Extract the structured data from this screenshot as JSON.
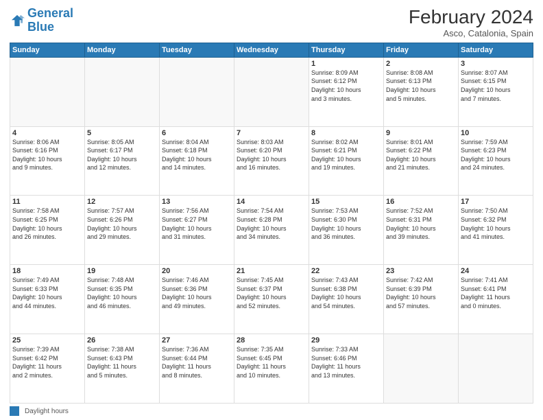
{
  "header": {
    "logo_line1": "General",
    "logo_line2": "Blue",
    "month_year": "February 2024",
    "location": "Asco, Catalonia, Spain"
  },
  "days_of_week": [
    "Sunday",
    "Monday",
    "Tuesday",
    "Wednesday",
    "Thursday",
    "Friday",
    "Saturday"
  ],
  "footer": {
    "legend_label": "Daylight hours"
  },
  "weeks": [
    [
      {
        "day": "",
        "info": ""
      },
      {
        "day": "",
        "info": ""
      },
      {
        "day": "",
        "info": ""
      },
      {
        "day": "",
        "info": ""
      },
      {
        "day": "1",
        "info": "Sunrise: 8:09 AM\nSunset: 6:12 PM\nDaylight: 10 hours\nand 3 minutes."
      },
      {
        "day": "2",
        "info": "Sunrise: 8:08 AM\nSunset: 6:13 PM\nDaylight: 10 hours\nand 5 minutes."
      },
      {
        "day": "3",
        "info": "Sunrise: 8:07 AM\nSunset: 6:15 PM\nDaylight: 10 hours\nand 7 minutes."
      }
    ],
    [
      {
        "day": "4",
        "info": "Sunrise: 8:06 AM\nSunset: 6:16 PM\nDaylight: 10 hours\nand 9 minutes."
      },
      {
        "day": "5",
        "info": "Sunrise: 8:05 AM\nSunset: 6:17 PM\nDaylight: 10 hours\nand 12 minutes."
      },
      {
        "day": "6",
        "info": "Sunrise: 8:04 AM\nSunset: 6:18 PM\nDaylight: 10 hours\nand 14 minutes."
      },
      {
        "day": "7",
        "info": "Sunrise: 8:03 AM\nSunset: 6:20 PM\nDaylight: 10 hours\nand 16 minutes."
      },
      {
        "day": "8",
        "info": "Sunrise: 8:02 AM\nSunset: 6:21 PM\nDaylight: 10 hours\nand 19 minutes."
      },
      {
        "day": "9",
        "info": "Sunrise: 8:01 AM\nSunset: 6:22 PM\nDaylight: 10 hours\nand 21 minutes."
      },
      {
        "day": "10",
        "info": "Sunrise: 7:59 AM\nSunset: 6:23 PM\nDaylight: 10 hours\nand 24 minutes."
      }
    ],
    [
      {
        "day": "11",
        "info": "Sunrise: 7:58 AM\nSunset: 6:25 PM\nDaylight: 10 hours\nand 26 minutes."
      },
      {
        "day": "12",
        "info": "Sunrise: 7:57 AM\nSunset: 6:26 PM\nDaylight: 10 hours\nand 29 minutes."
      },
      {
        "day": "13",
        "info": "Sunrise: 7:56 AM\nSunset: 6:27 PM\nDaylight: 10 hours\nand 31 minutes."
      },
      {
        "day": "14",
        "info": "Sunrise: 7:54 AM\nSunset: 6:28 PM\nDaylight: 10 hours\nand 34 minutes."
      },
      {
        "day": "15",
        "info": "Sunrise: 7:53 AM\nSunset: 6:30 PM\nDaylight: 10 hours\nand 36 minutes."
      },
      {
        "day": "16",
        "info": "Sunrise: 7:52 AM\nSunset: 6:31 PM\nDaylight: 10 hours\nand 39 minutes."
      },
      {
        "day": "17",
        "info": "Sunrise: 7:50 AM\nSunset: 6:32 PM\nDaylight: 10 hours\nand 41 minutes."
      }
    ],
    [
      {
        "day": "18",
        "info": "Sunrise: 7:49 AM\nSunset: 6:33 PM\nDaylight: 10 hours\nand 44 minutes."
      },
      {
        "day": "19",
        "info": "Sunrise: 7:48 AM\nSunset: 6:35 PM\nDaylight: 10 hours\nand 46 minutes."
      },
      {
        "day": "20",
        "info": "Sunrise: 7:46 AM\nSunset: 6:36 PM\nDaylight: 10 hours\nand 49 minutes."
      },
      {
        "day": "21",
        "info": "Sunrise: 7:45 AM\nSunset: 6:37 PM\nDaylight: 10 hours\nand 52 minutes."
      },
      {
        "day": "22",
        "info": "Sunrise: 7:43 AM\nSunset: 6:38 PM\nDaylight: 10 hours\nand 54 minutes."
      },
      {
        "day": "23",
        "info": "Sunrise: 7:42 AM\nSunset: 6:39 PM\nDaylight: 10 hours\nand 57 minutes."
      },
      {
        "day": "24",
        "info": "Sunrise: 7:41 AM\nSunset: 6:41 PM\nDaylight: 11 hours\nand 0 minutes."
      }
    ],
    [
      {
        "day": "25",
        "info": "Sunrise: 7:39 AM\nSunset: 6:42 PM\nDaylight: 11 hours\nand 2 minutes."
      },
      {
        "day": "26",
        "info": "Sunrise: 7:38 AM\nSunset: 6:43 PM\nDaylight: 11 hours\nand 5 minutes."
      },
      {
        "day": "27",
        "info": "Sunrise: 7:36 AM\nSunset: 6:44 PM\nDaylight: 11 hours\nand 8 minutes."
      },
      {
        "day": "28",
        "info": "Sunrise: 7:35 AM\nSunset: 6:45 PM\nDaylight: 11 hours\nand 10 minutes."
      },
      {
        "day": "29",
        "info": "Sunrise: 7:33 AM\nSunset: 6:46 PM\nDaylight: 11 hours\nand 13 minutes."
      },
      {
        "day": "",
        "info": ""
      },
      {
        "day": "",
        "info": ""
      }
    ]
  ]
}
